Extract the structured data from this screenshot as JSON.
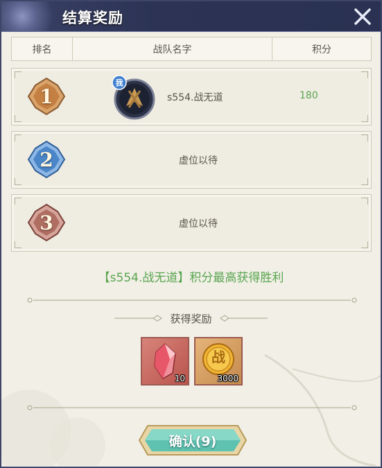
{
  "dialog": {
    "title": "结算奖励"
  },
  "table": {
    "headers": {
      "rank": "排名",
      "team": "战队名字",
      "score": "积分"
    }
  },
  "rows": [
    {
      "rank": "1",
      "team_name": "s554.战无道",
      "score": "180",
      "self_badge": "我",
      "badge_color": "#c98e52"
    },
    {
      "rank": "2",
      "placeholder": "虚位以待",
      "badge_color": "#4a86c8"
    },
    {
      "rank": "3",
      "placeholder": "虚位以待",
      "badge_color": "#b06e62"
    }
  ],
  "result": {
    "message": "【s554.战无道】积分最高获得胜利"
  },
  "rewards": {
    "title": "获得奖励",
    "items": [
      {
        "icon": "red-crystal-icon",
        "count": "10"
      },
      {
        "icon": "battle-coin-icon",
        "coin_text": "战",
        "count": "3000"
      }
    ]
  },
  "confirm": {
    "label": "确认(9)"
  },
  "colors": {
    "accent_green": "#5aa550",
    "header_bg": "#2c3355",
    "panel_bg": "#f1efe6"
  }
}
